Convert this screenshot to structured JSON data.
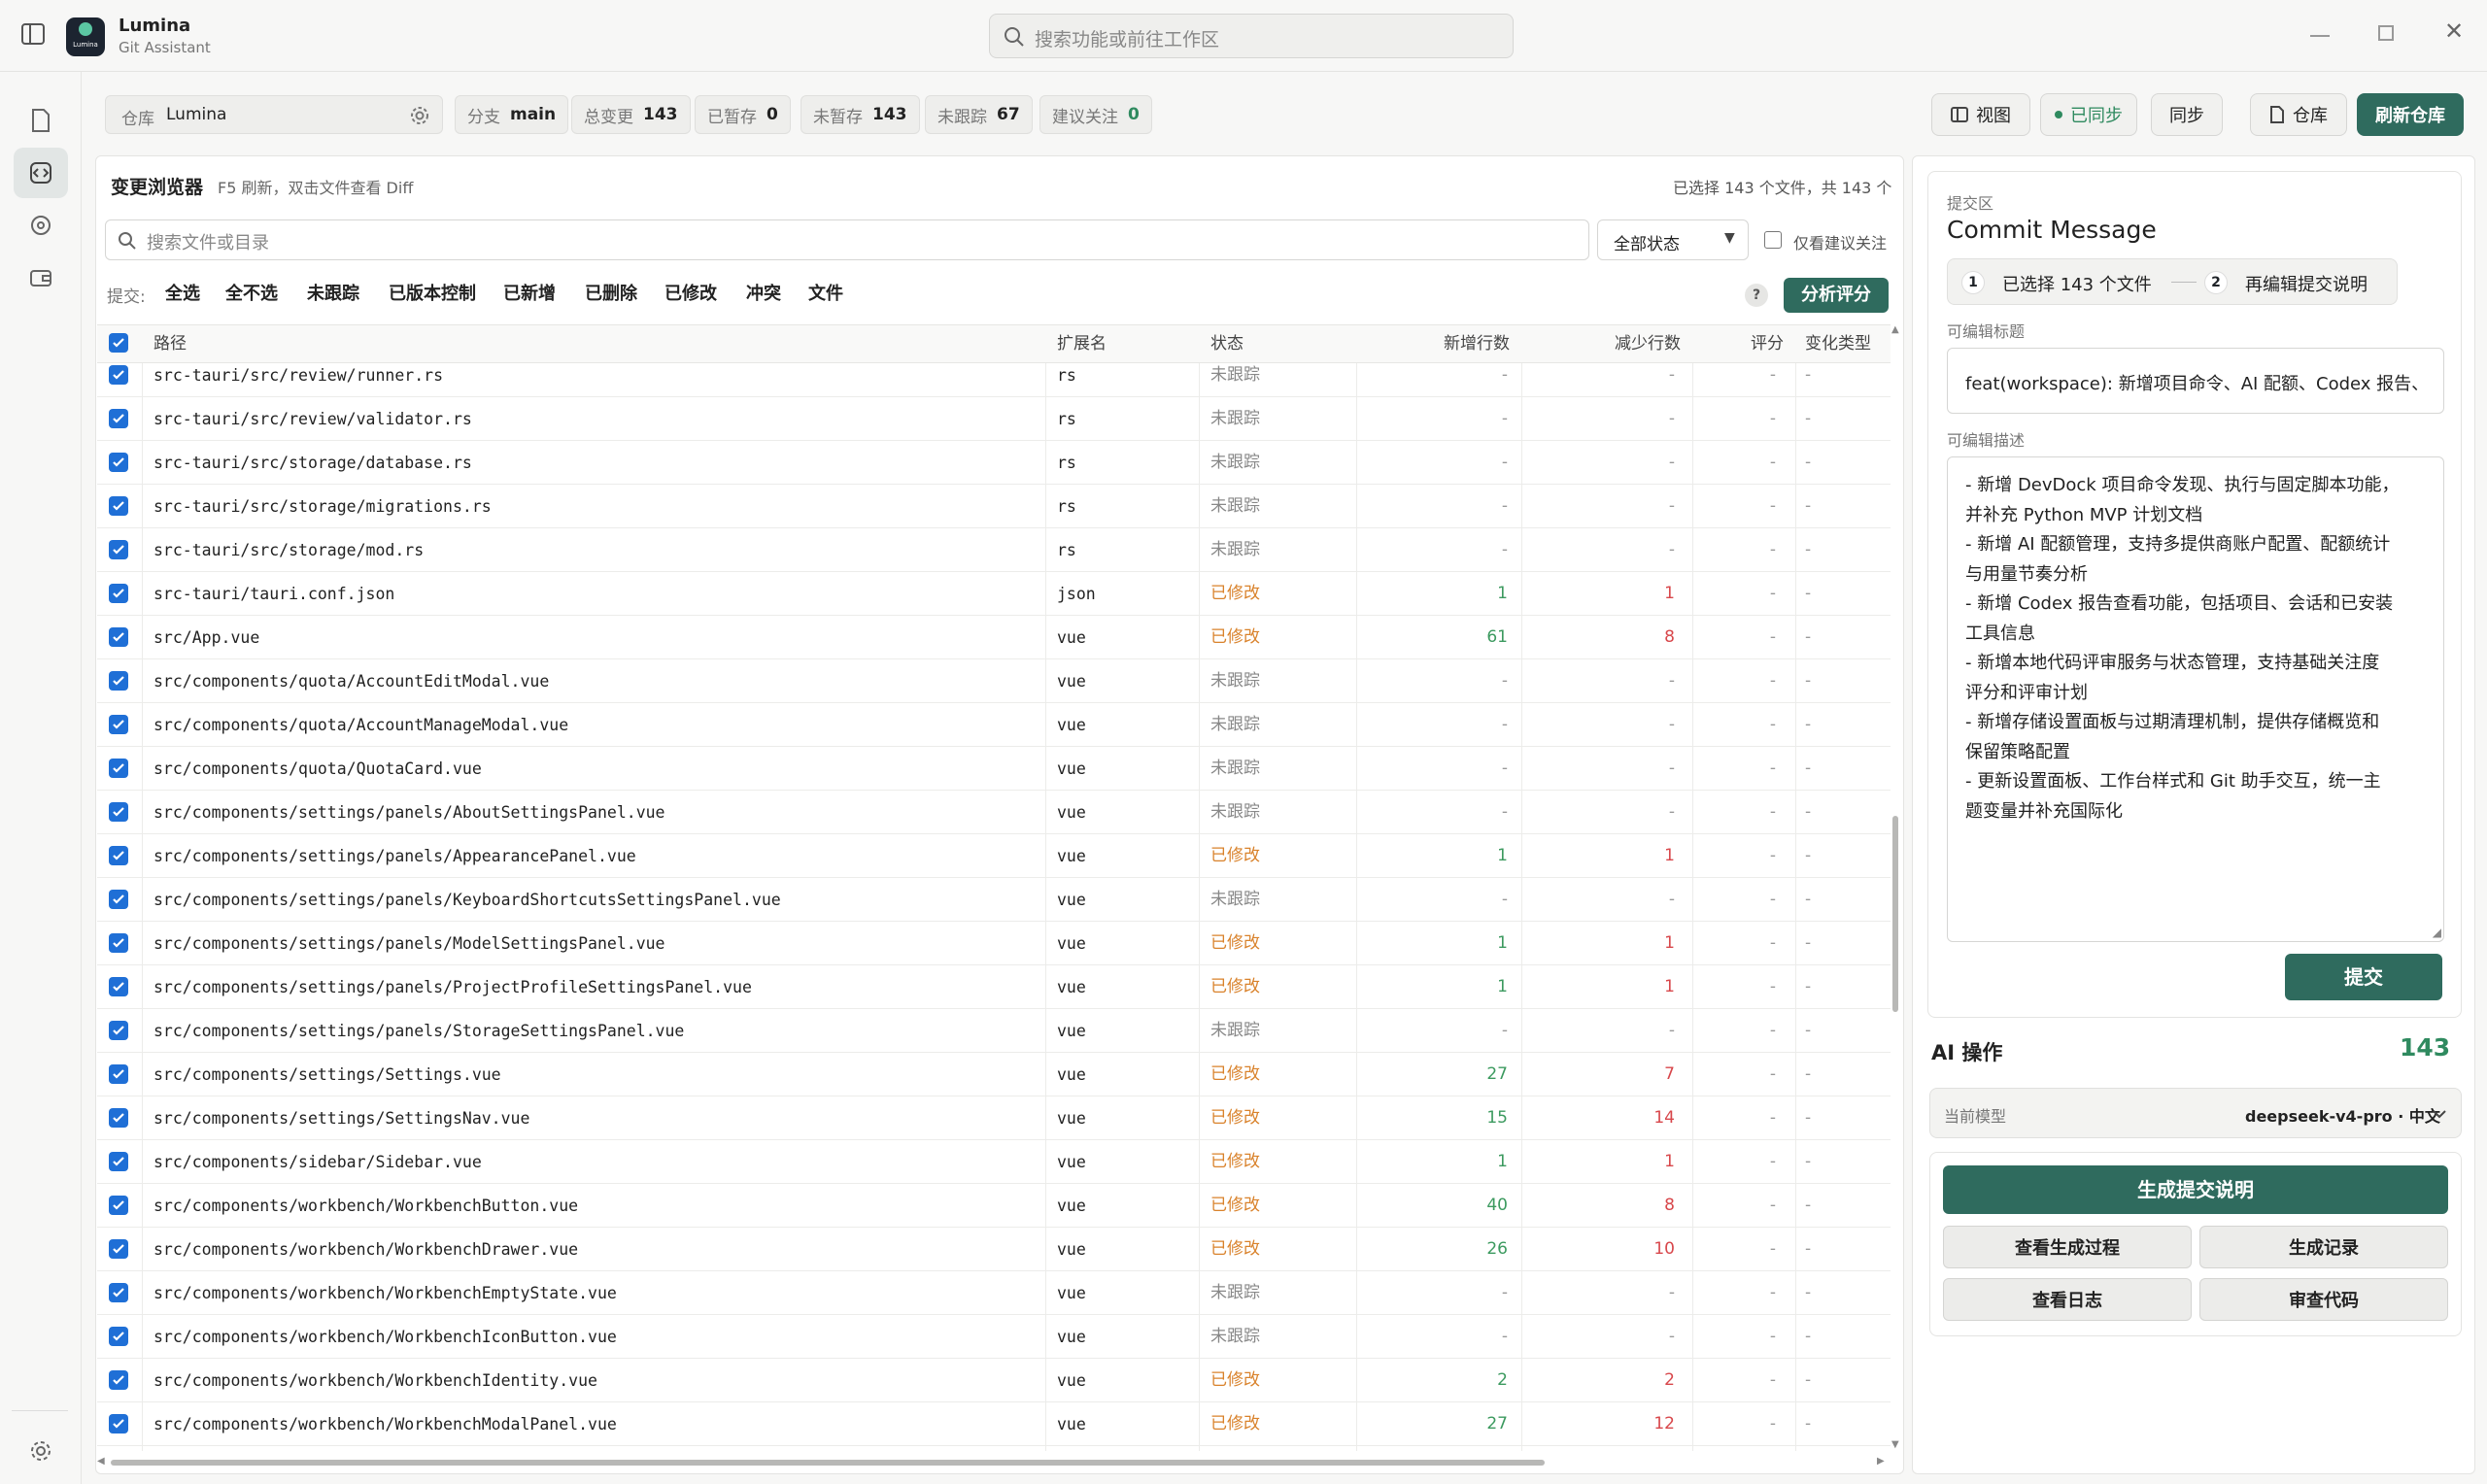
{
  "app": {
    "name": "Lumina",
    "subtitle": "Git Assistant",
    "logo_text": "Lumina"
  },
  "search": {
    "placeholder": "搜索功能或前往工作区"
  },
  "toolbar": {
    "repo_label": "仓库",
    "repo_value": "Lumina",
    "chips": [
      {
        "k": "分支",
        "v": "main"
      },
      {
        "k": "总变更",
        "v": "143"
      },
      {
        "k": "已暂存",
        "v": "0"
      },
      {
        "k": "未暂存",
        "v": "143"
      },
      {
        "k": "未跟踪",
        "v": "67"
      },
      {
        "k": "建议关注",
        "v": "0"
      }
    ],
    "view_label": "视图",
    "synced_label": "已同步",
    "sync_label": "同步",
    "repo_btn_label": "仓库",
    "refresh_label": "刷新仓库"
  },
  "browser": {
    "title": "变更浏览器",
    "hint": "F5 刷新，双击文件查看 Diff",
    "selection_summary": "已选择 143 个文件，共 143 个",
    "search_placeholder": "搜索文件或目录",
    "status_filter": "全部状态",
    "only_suggested": "仅看建议关注",
    "action_prefix": "提交:",
    "actions": [
      "全选",
      "全不选",
      "未跟踪",
      "已版本控制",
      "已新增",
      "已删除",
      "已修改",
      "冲突",
      "文件"
    ],
    "help": "?",
    "analyze_label": "分析评分",
    "columns": {
      "path": "路径",
      "ext": "扩展名",
      "status": "状态",
      "added": "新增行数",
      "removed": "减少行数",
      "score": "评分",
      "change": "变化类型"
    },
    "rows": [
      {
        "path": "src-tauri/src/review/runner.rs",
        "ext": "rs",
        "status": "未跟踪",
        "added": "-",
        "removed": "-",
        "score": "-",
        "change": "-"
      },
      {
        "path": "src-tauri/src/review/validator.rs",
        "ext": "rs",
        "status": "未跟踪",
        "added": "-",
        "removed": "-",
        "score": "-",
        "change": "-"
      },
      {
        "path": "src-tauri/src/storage/database.rs",
        "ext": "rs",
        "status": "未跟踪",
        "added": "-",
        "removed": "-",
        "score": "-",
        "change": "-"
      },
      {
        "path": "src-tauri/src/storage/migrations.rs",
        "ext": "rs",
        "status": "未跟踪",
        "added": "-",
        "removed": "-",
        "score": "-",
        "change": "-"
      },
      {
        "path": "src-tauri/src/storage/mod.rs",
        "ext": "rs",
        "status": "未跟踪",
        "added": "-",
        "removed": "-",
        "score": "-",
        "change": "-"
      },
      {
        "path": "src-tauri/tauri.conf.json",
        "ext": "json",
        "status": "已修改",
        "added": "1",
        "removed": "1",
        "score": "-",
        "change": "-"
      },
      {
        "path": "src/App.vue",
        "ext": "vue",
        "status": "已修改",
        "added": "61",
        "removed": "8",
        "score": "-",
        "change": "-"
      },
      {
        "path": "src/components/quota/AccountEditModal.vue",
        "ext": "vue",
        "status": "未跟踪",
        "added": "-",
        "removed": "-",
        "score": "-",
        "change": "-"
      },
      {
        "path": "src/components/quota/AccountManageModal.vue",
        "ext": "vue",
        "status": "未跟踪",
        "added": "-",
        "removed": "-",
        "score": "-",
        "change": "-"
      },
      {
        "path": "src/components/quota/QuotaCard.vue",
        "ext": "vue",
        "status": "未跟踪",
        "added": "-",
        "removed": "-",
        "score": "-",
        "change": "-"
      },
      {
        "path": "src/components/settings/panels/AboutSettingsPanel.vue",
        "ext": "vue",
        "status": "未跟踪",
        "added": "-",
        "removed": "-",
        "score": "-",
        "change": "-"
      },
      {
        "path": "src/components/settings/panels/AppearancePanel.vue",
        "ext": "vue",
        "status": "已修改",
        "added": "1",
        "removed": "1",
        "score": "-",
        "change": "-"
      },
      {
        "path": "src/components/settings/panels/KeyboardShortcutsSettingsPanel.vue",
        "ext": "vue",
        "status": "未跟踪",
        "added": "-",
        "removed": "-",
        "score": "-",
        "change": "-"
      },
      {
        "path": "src/components/settings/panels/ModelSettingsPanel.vue",
        "ext": "vue",
        "status": "已修改",
        "added": "1",
        "removed": "1",
        "score": "-",
        "change": "-"
      },
      {
        "path": "src/components/settings/panels/ProjectProfileSettingsPanel.vue",
        "ext": "vue",
        "status": "已修改",
        "added": "1",
        "removed": "1",
        "score": "-",
        "change": "-"
      },
      {
        "path": "src/components/settings/panels/StorageSettingsPanel.vue",
        "ext": "vue",
        "status": "未跟踪",
        "added": "-",
        "removed": "-",
        "score": "-",
        "change": "-"
      },
      {
        "path": "src/components/settings/Settings.vue",
        "ext": "vue",
        "status": "已修改",
        "added": "27",
        "removed": "7",
        "score": "-",
        "change": "-"
      },
      {
        "path": "src/components/settings/SettingsNav.vue",
        "ext": "vue",
        "status": "已修改",
        "added": "15",
        "removed": "14",
        "score": "-",
        "change": "-"
      },
      {
        "path": "src/components/sidebar/Sidebar.vue",
        "ext": "vue",
        "status": "已修改",
        "added": "1",
        "removed": "1",
        "score": "-",
        "change": "-"
      },
      {
        "path": "src/components/workbench/WorkbenchButton.vue",
        "ext": "vue",
        "status": "已修改",
        "added": "40",
        "removed": "8",
        "score": "-",
        "change": "-"
      },
      {
        "path": "src/components/workbench/WorkbenchDrawer.vue",
        "ext": "vue",
        "status": "已修改",
        "added": "26",
        "removed": "10",
        "score": "-",
        "change": "-"
      },
      {
        "path": "src/components/workbench/WorkbenchEmptyState.vue",
        "ext": "vue",
        "status": "未跟踪",
        "added": "-",
        "removed": "-",
        "score": "-",
        "change": "-"
      },
      {
        "path": "src/components/workbench/WorkbenchIconButton.vue",
        "ext": "vue",
        "status": "未跟踪",
        "added": "-",
        "removed": "-",
        "score": "-",
        "change": "-"
      },
      {
        "path": "src/components/workbench/WorkbenchIdentity.vue",
        "ext": "vue",
        "status": "已修改",
        "added": "2",
        "removed": "2",
        "score": "-",
        "change": "-"
      },
      {
        "path": "src/components/workbench/WorkbenchModalPanel.vue",
        "ext": "vue",
        "status": "已修改",
        "added": "27",
        "removed": "12",
        "score": "-",
        "change": "-"
      }
    ]
  },
  "commit": {
    "section_label": "提交区",
    "title": "Commit Message",
    "step1_num": "1",
    "step1": "已选择 143 个文件",
    "step2_num": "2",
    "step2": "再编辑提交说明",
    "subject_label": "可编辑标题",
    "subject_value": "feat(workspace): 新增项目命令、AI 配额、Codex 报告、",
    "desc_label": "可编辑描述",
    "desc_lines": [
      "- 新增 DevDock 项目命令发现、执行与固定脚本功能，",
      "并补充 Python MVP 计划文档",
      "- 新增 AI 配额管理，支持多提供商账户配置、配额统计",
      "与用量节奏分析",
      "- 新增 Codex 报告查看功能，包括项目、会话和已安装",
      "工具信息",
      "- 新增本地代码评审服务与状态管理，支持基础关注度",
      "评分和评审计划",
      "- 新增存储设置面板与过期清理机制，提供存储概览和",
      "保留策略配置",
      "- 更新设置面板、工作台样式和 Git 助手交互，统一主",
      "题变量并补充国际化"
    ],
    "submit_label": "提交"
  },
  "ai": {
    "title": "AI 操作",
    "count": "143",
    "model_label": "当前模型",
    "model_value": "deepseek-v4-pro · 中文",
    "generate_label": "生成提交说明",
    "buttons": [
      "查看生成过程",
      "生成记录",
      "查看日志",
      "审查代码"
    ]
  },
  "colors": {
    "accent": "#2f6b5e",
    "modified": "#d9822b",
    "added": "#3c9a5f",
    "removed": "#d8474b",
    "checkbox": "#1f6fd6"
  }
}
